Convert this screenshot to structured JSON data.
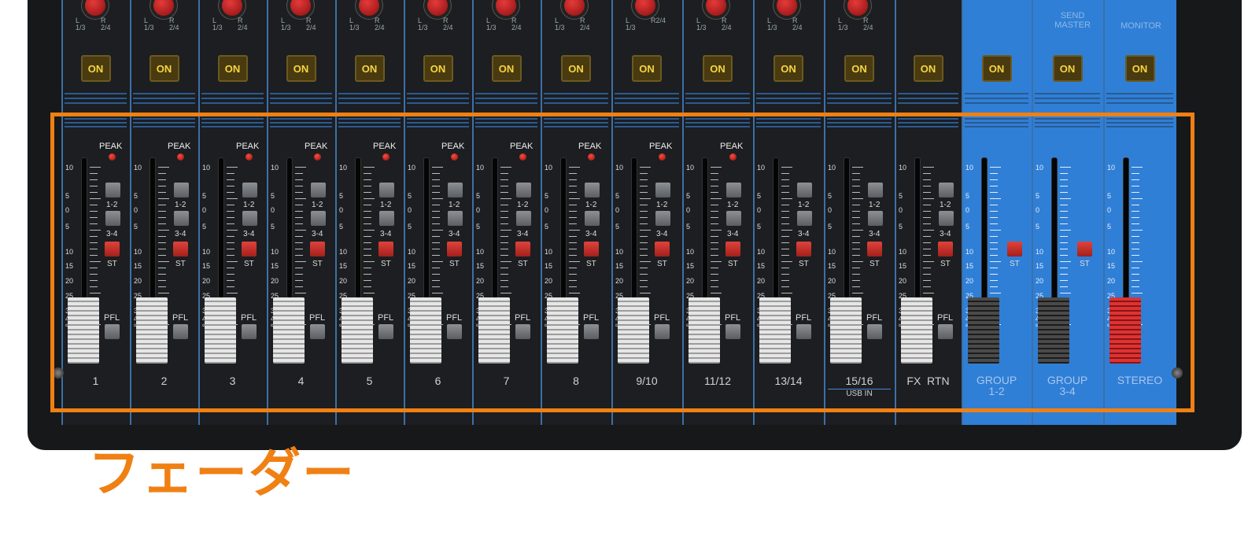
{
  "channels": [
    {
      "label": "1",
      "pan_l": "L\n1/3",
      "pan_r": "R\n2/4",
      "on": "ON",
      "peak": "PEAK",
      "pfl": "PFL",
      "bus": [
        "1-2",
        "3-4",
        "ST"
      ],
      "blue": false,
      "cap": "grey",
      "fader_level": 0.1
    },
    {
      "label": "2",
      "pan_l": "L\n1/3",
      "pan_r": "R\n2/4",
      "on": "ON",
      "peak": "PEAK",
      "pfl": "PFL",
      "bus": [
        "1-2",
        "3-4",
        "ST"
      ],
      "blue": false,
      "cap": "grey",
      "fader_level": 0.1
    },
    {
      "label": "3",
      "pan_l": "L\n1/3",
      "pan_r": "R\n2/4",
      "on": "ON",
      "peak": "PEAK",
      "pfl": "PFL",
      "bus": [
        "1-2",
        "3-4",
        "ST"
      ],
      "blue": false,
      "cap": "grey",
      "fader_level": 0.1
    },
    {
      "label": "4",
      "pan_l": "L\n1/3",
      "pan_r": "R\n2/4",
      "on": "ON",
      "peak": "PEAK",
      "pfl": "PFL",
      "bus": [
        "1-2",
        "3-4",
        "ST"
      ],
      "blue": false,
      "cap": "grey",
      "fader_level": 0.1
    },
    {
      "label": "5",
      "pan_l": "L\n1/3",
      "pan_r": "R\n2/4",
      "on": "ON",
      "peak": "PEAK",
      "pfl": "PFL",
      "bus": [
        "1-2",
        "3-4",
        "ST"
      ],
      "blue": false,
      "cap": "grey",
      "fader_level": 0.1
    },
    {
      "label": "6",
      "pan_l": "L\n1/3",
      "pan_r": "R\n2/4",
      "on": "ON",
      "peak": "PEAK",
      "pfl": "PFL",
      "bus": [
        "1-2",
        "3-4",
        "ST"
      ],
      "blue": false,
      "cap": "grey",
      "fader_level": 0.1
    },
    {
      "label": "7",
      "pan_l": "L\n1/3",
      "pan_r": "R\n2/4",
      "on": "ON",
      "peak": "PEAK",
      "pfl": "PFL",
      "bus": [
        "1-2",
        "3-4",
        "ST"
      ],
      "blue": false,
      "cap": "grey",
      "fader_level": 0.1
    },
    {
      "label": "8",
      "pan_l": "L\n1/3",
      "pan_r": "R\n2/4",
      "on": "ON",
      "peak": "PEAK",
      "pfl": "PFL",
      "bus": [
        "1-2",
        "3-4",
        "ST"
      ],
      "blue": false,
      "cap": "grey",
      "fader_level": 0.1
    },
    {
      "label": "9/10",
      "pan_l": "L\n1/3",
      "pan_r": "R2/4",
      "on": "ON",
      "peak": "PEAK",
      "pfl": "PFL",
      "bus": [
        "1-2",
        "3-4",
        "ST"
      ],
      "blue": false,
      "cap": "grey",
      "fader_level": 0.1
    },
    {
      "label": "11/12",
      "pan_l": "L\n1/3",
      "pan_r": "R\n2/4",
      "on": "ON",
      "peak": "PEAK",
      "pfl": "PFL",
      "bus": [
        "1-2",
        "3-4",
        "ST"
      ],
      "blue": false,
      "cap": "grey",
      "fader_level": 0.1
    },
    {
      "label": "13/14",
      "pan_l": "L\n1/3",
      "pan_r": "R\n2/4",
      "on": "ON",
      "peak": "",
      "pfl": "PFL",
      "bus": [
        "1-2",
        "3-4",
        "ST"
      ],
      "blue": false,
      "cap": "grey",
      "fader_level": 0.1
    },
    {
      "label": "15/16",
      "sub": "USB IN",
      "pan_l": "L\n1/3",
      "pan_r": "R\n2/4",
      "on": "ON",
      "peak": "",
      "pfl": "PFL",
      "bus": [
        "1-2",
        "3-4",
        "ST"
      ],
      "blue": false,
      "cap": "grey",
      "fader_level": 0.1
    },
    {
      "label": "FX  RTN",
      "pan_l": "",
      "pan_r": "",
      "on": "ON",
      "peak": "",
      "pfl": "PFL",
      "bus": [
        "1-2",
        "3-4",
        "ST"
      ],
      "blue": false,
      "cap": "grey",
      "fader_level": 0.1
    },
    {
      "label": "GROUP\n1-2",
      "pan_l": "",
      "pan_r": "",
      "on": "ON",
      "peak": "",
      "pfl": "",
      "bus": [
        "",
        "",
        "ST"
      ],
      "blue": true,
      "cap": "dark",
      "fader_level": 0.1
    },
    {
      "label": "GROUP\n3-4",
      "pan_l": "",
      "pan_r": "",
      "on": "ON",
      "peak": "",
      "pfl": "",
      "bus": [
        "",
        "",
        "ST"
      ],
      "blue": true,
      "cap": "dark",
      "fader_level": 0.1
    },
    {
      "label": "STEREO",
      "pan_l": "",
      "pan_r": "",
      "on": "ON",
      "peak": "",
      "pfl": "",
      "bus": [
        "",
        "",
        ""
      ],
      "blue": true,
      "cap": "red",
      "fader_level": 0.1
    }
  ],
  "scale_marks": [
    "10",
    "5",
    "0",
    "5",
    "10",
    "15",
    "20",
    "25",
    "30",
    "40",
    "∞"
  ],
  "top_right": {
    "send_master": "SEND\nMASTER",
    "monitor": "MONITOR"
  },
  "caption": "フェーダー"
}
